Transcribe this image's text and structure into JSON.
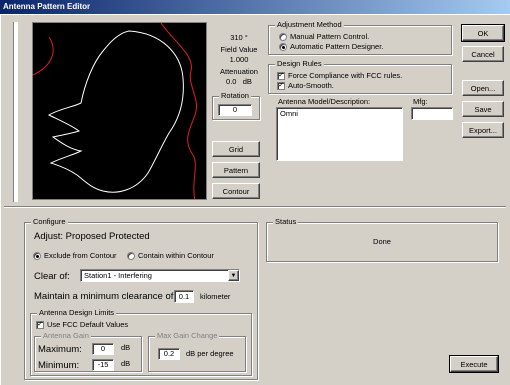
{
  "window": {
    "title": "Antenna Pattern Editor"
  },
  "readout": {
    "azimuth": "310 °",
    "field_value_label": "Field Value",
    "field_value": "1.000",
    "attenuation_label": "Attenuation",
    "attenuation_value": "0.0",
    "attenuation_unit": "dB",
    "rotation_label": "Rotation",
    "rotation_value": "0"
  },
  "view_buttons": {
    "grid": "Grid",
    "pattern": "Pattern",
    "contour": "Contour"
  },
  "adjustment_method": {
    "label": "Adjustment Method",
    "manual": "Manual Pattern Control.",
    "automatic": "Automatic Pattern Designer.",
    "selected": "automatic"
  },
  "design_rules": {
    "label": "Design Rules",
    "force_fcc": "Force Compliance with FCC rules.",
    "auto_smooth": "Auto-Smooth."
  },
  "antenna_model": {
    "label": "Antenna Model/Description:",
    "value": "Omni"
  },
  "mfg": {
    "label": "Mfg:",
    "value": ""
  },
  "action_buttons": {
    "ok": "OK",
    "cancel": "Cancel",
    "open": "Open...",
    "save": "Save",
    "export": "Export..."
  },
  "configure": {
    "label": "Configure",
    "adjust": "Adjust:  Proposed Protected",
    "exclude": "Exclude from Contour",
    "contain": "Contain within Contour",
    "clear_of_label": "Clear of:",
    "clear_of_value": "Station1 - Interfering",
    "clearance_label": "Maintain a minimum clearance of:",
    "clearance_value": "0.1",
    "clearance_unit": "kilometer"
  },
  "design_limits": {
    "label": "Antenna Design Limits",
    "use_fcc": "Use FCC Default Values",
    "antenna_gain_label": "Antenna Gain",
    "maximum_label": "Maximum:",
    "maximum_value": "0",
    "minimum_label": "Minimum:",
    "minimum_value": "-15",
    "unit": "dB",
    "max_gain_change_label": "Max Gain Change",
    "max_gain_change_value": "0.2",
    "max_gain_change_unit": "dB per degree"
  },
  "status": {
    "label": "Status",
    "value": "Done"
  },
  "execute": "Execute"
}
